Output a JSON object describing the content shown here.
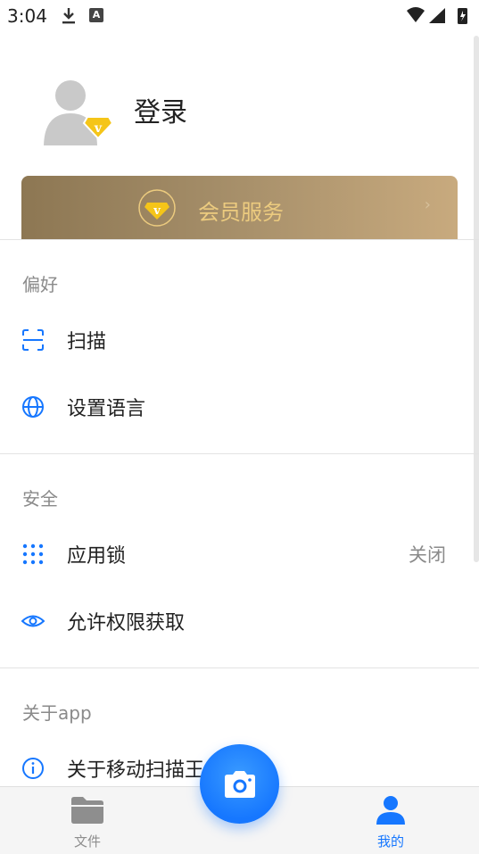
{
  "status_bar": {
    "time": "3:04",
    "keyboard_badge": "A"
  },
  "profile": {
    "login_label": "登录"
  },
  "vip": {
    "label": "会员服务",
    "chevron": "›"
  },
  "sections": {
    "preferences": {
      "title": "偏好",
      "items": [
        {
          "label": "扫描",
          "icon": "scan-icon"
        },
        {
          "label": "设置语言",
          "icon": "globe-icon"
        }
      ]
    },
    "security": {
      "title": "安全",
      "items": [
        {
          "label": "应用锁",
          "value": "关闭",
          "icon": "dots-grid-icon"
        },
        {
          "label": "允许权限获取",
          "icon": "eye-icon"
        }
      ]
    },
    "about": {
      "title": "关于app",
      "items": [
        {
          "label": "关于移动扫描王",
          "icon": "info-icon"
        }
      ]
    }
  },
  "bottom_nav": {
    "files_label": "文件",
    "me_label": "我的"
  },
  "colors": {
    "accent": "#1677ff",
    "vip_gold": "#eccb7f",
    "muted": "#8a8a8a"
  }
}
